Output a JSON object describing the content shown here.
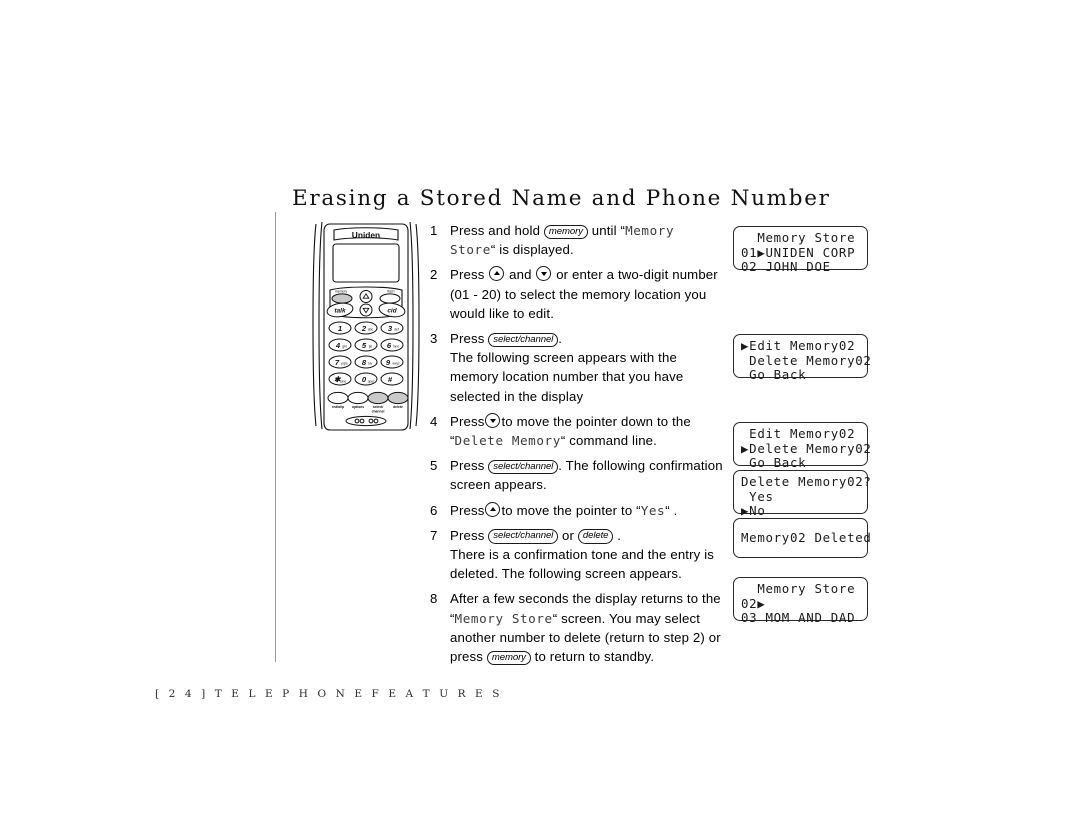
{
  "document": {
    "title": "Erasing a Stored Name and Phone Number",
    "footer": "[ 2 4 ]   T E L E P H O N E    F E A T U R E S",
    "footer_page_number": "24",
    "footer_section": "TELEPHONE FEATURES"
  },
  "phone_illustration": {
    "brand": "Uniden",
    "soft_key_labels": {
      "memory": "memory",
      "flash": "flash"
    },
    "action_buttons": {
      "talk": "talk",
      "cid": "cid"
    },
    "keypad": [
      {
        "digit": "1",
        "letters": ""
      },
      {
        "digit": "2",
        "letters": "abc"
      },
      {
        "digit": "3",
        "letters": "def"
      },
      {
        "digit": "4",
        "letters": "ghi"
      },
      {
        "digit": "5",
        "letters": "jkl"
      },
      {
        "digit": "6",
        "letters": "mno"
      },
      {
        "digit": "7",
        "letters": "pqrs"
      },
      {
        "digit": "8",
        "letters": "tuv"
      },
      {
        "digit": "9",
        "letters": "wxyz"
      },
      {
        "digit": "*",
        "letters": "tone"
      },
      {
        "digit": "0",
        "letters": "oper"
      },
      {
        "digit": "#",
        "letters": ""
      }
    ],
    "bottom_buttons": [
      "redial/p",
      "options",
      "select/\nchannel",
      "delete"
    ]
  },
  "steps": [
    {
      "number": "1",
      "parts": [
        {
          "type": "text",
          "value": "Press and hold "
        },
        {
          "type": "pill",
          "value": "memory"
        },
        {
          "type": "text",
          "value": " until “"
        },
        {
          "type": "lcd",
          "value": "Memory Store"
        },
        {
          "type": "text",
          "value": "“ is displayed."
        }
      ]
    },
    {
      "number": "2",
      "parts": [
        {
          "type": "text",
          "value": "Press "
        },
        {
          "type": "key-up",
          "value": "▲"
        },
        {
          "type": "text",
          "value": " and "
        },
        {
          "type": "key-down",
          "value": "▼"
        },
        {
          "type": "text",
          "value": " or enter a two-digit number (01 - 20) to select the memory location you would like to edit."
        }
      ]
    },
    {
      "number": "3",
      "parts": [
        {
          "type": "text",
          "value": "Press "
        },
        {
          "type": "pill",
          "value": "select/channel"
        },
        {
          "type": "text",
          "value": ". "
        },
        {
          "type": "break",
          "value": ""
        },
        {
          "type": "text",
          "value": "The following screen appears with the memory location number that you have selected in the display"
        }
      ]
    },
    {
      "number": "4",
      "parts": [
        {
          "type": "text",
          "value": "Press"
        },
        {
          "type": "key-down",
          "value": "▼"
        },
        {
          "type": "text",
          "value": "to move the pointer down to the “"
        },
        {
          "type": "lcd",
          "value": "Delete Memory"
        },
        {
          "type": "text",
          "value": "“ command line."
        }
      ]
    },
    {
      "number": "5",
      "parts": [
        {
          "type": "text",
          "value": "Press "
        },
        {
          "type": "pill",
          "value": "select/channel"
        },
        {
          "type": "text",
          "value": ". The following confirmation screen appears."
        }
      ]
    },
    {
      "number": "6",
      "parts": [
        {
          "type": "text",
          "value": "Press"
        },
        {
          "type": "key-up",
          "value": "▲"
        },
        {
          "type": "text",
          "value": "to move the pointer to “"
        },
        {
          "type": "lcd",
          "value": "Yes"
        },
        {
          "type": "text",
          "value": "“ ."
        }
      ]
    },
    {
      "number": "7",
      "parts": [
        {
          "type": "text",
          "value": "Press "
        },
        {
          "type": "pill",
          "value": "select/channel"
        },
        {
          "type": "text",
          "value": " or "
        },
        {
          "type": "pill",
          "value": "delete"
        },
        {
          "type": "text",
          "value": " . "
        },
        {
          "type": "break",
          "value": ""
        },
        {
          "type": "text",
          "value": "There is a confirmation tone and the entry is deleted. The following screen appears."
        }
      ]
    },
    {
      "number": "8",
      "parts": [
        {
          "type": "text",
          "value": "After a few seconds the display returns to the “"
        },
        {
          "type": "lcd",
          "value": "Memory Store"
        },
        {
          "type": "text",
          "value": "“ screen. You may select another number to delete (return to step 2) or press "
        },
        {
          "type": "pill",
          "value": "memory"
        },
        {
          "type": "text",
          "value": " to return to standby."
        }
      ]
    }
  ],
  "lcd_screens": {
    "memory_store_1": {
      "name": "Memory Store list",
      "rows": [
        "  Memory Store",
        "01▶UNIDEN CORP",
        "02 JOHN DOE"
      ]
    },
    "edit_menu": {
      "name": "Edit memory menu with pointer on Edit",
      "rows": [
        "▶Edit Memory02",
        " Delete Memory02",
        " Go Back"
      ]
    },
    "delete_menu": {
      "name": "Edit memory menu with pointer on Delete",
      "rows": [
        " Edit Memory02",
        "▶Delete Memory02",
        " Go Back"
      ]
    },
    "confirm": {
      "name": "Delete confirmation",
      "rows": [
        "Delete Memory02?",
        " Yes",
        "▶No"
      ]
    },
    "deleted": {
      "name": "Deletion confirmation message",
      "rows": [
        "Memory02 Deleted"
      ]
    },
    "memory_store_2": {
      "name": "Memory Store list after deletion",
      "rows": [
        "  Memory Store",
        "02▶",
        "03 MOM AND DAD"
      ]
    }
  }
}
